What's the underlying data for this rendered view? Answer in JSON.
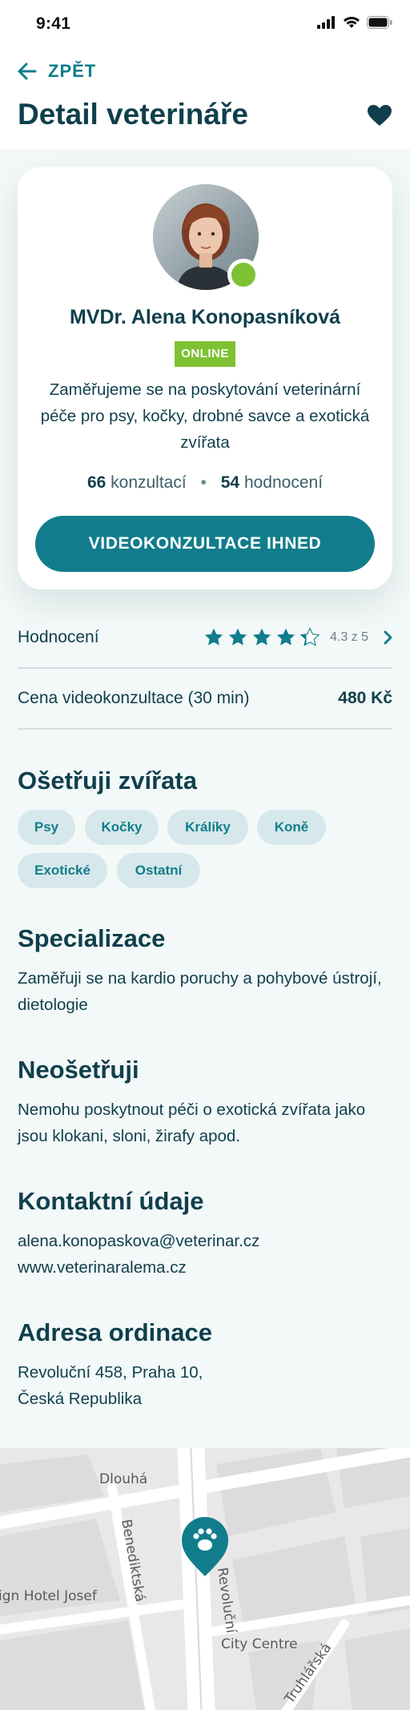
{
  "status": {
    "time": "9:41"
  },
  "header": {
    "back_label": "ZPĚT",
    "title": "Detail veterináře"
  },
  "vet": {
    "name": "MVDr. Alena Konopasníková",
    "status_badge": "ONLINE",
    "description": "Zaměřujeme se na poskytování veterinární péče pro psy, kočky, drobné savce a exotická zvířata",
    "consultations_count": "66",
    "consultations_label": "konzultací",
    "ratings_count": "54",
    "ratings_label": "hodnocení",
    "cta_label": "VIDEOKONZULTACE IHNED"
  },
  "rating": {
    "label": "Hodnocení",
    "value": 4.3,
    "max": 5,
    "text": "4.3 z 5"
  },
  "price": {
    "label": "Cena videokonzultace (30 min)",
    "value": "480 Kč"
  },
  "animals": {
    "title": "Ošetřuji zvířata",
    "chips": [
      "Psy",
      "Kočky",
      "Králíky",
      "Koně",
      "Exotické",
      "Ostatní"
    ]
  },
  "specialization": {
    "title": "Specializace",
    "text": "Zaměřuji se na kardio poruchy a pohybové ústrojí, dietologie"
  },
  "not_treating": {
    "title": "Neošetřuji",
    "text": "Nemohu poskytnout péči o exotická zvířata jako jsou klokani, sloni, žirafy apod."
  },
  "contact": {
    "title": "Kontaktní údaje",
    "email": "alena.konopaskova@veterinar.cz",
    "web": "www.veterinaralema.cz"
  },
  "address": {
    "title": "Adresa ordinace",
    "line1": "Revoluční 458, Praha 10,",
    "line2": "Česká Republika"
  },
  "map": {
    "labels": {
      "dlouha": "Dlouhá",
      "benediktska": "Benediktská",
      "hotel": "ign Hotel Josef",
      "revolucni": "Revoluční",
      "city_centre": "City Centre",
      "truhlarska": "Truhlářská"
    },
    "pin_icon": "paw-icon"
  },
  "colors": {
    "primary": "#117d8c",
    "dark": "#0f3f4c",
    "online": "#7ec234",
    "chip_bg": "#d6e8eb"
  }
}
